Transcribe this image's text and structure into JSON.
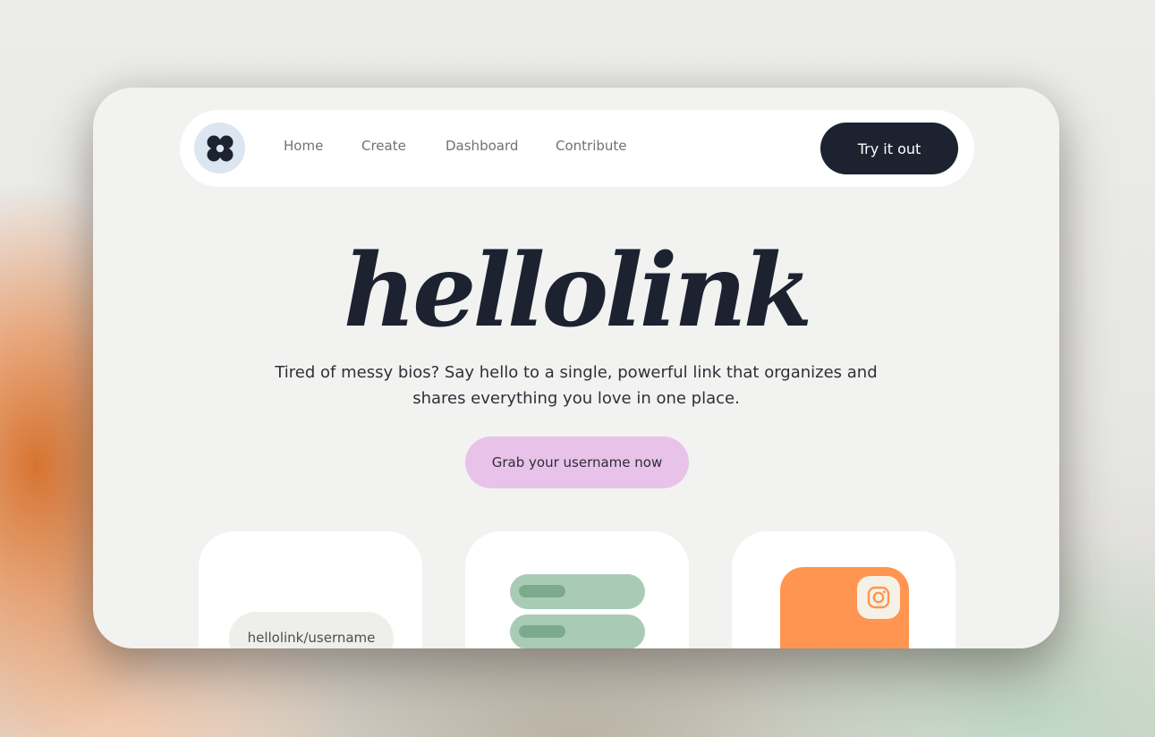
{
  "nav": {
    "logo_icon": "flower-logo-icon",
    "links": [
      {
        "label": "Home"
      },
      {
        "label": "Create"
      },
      {
        "label": "Dashboard"
      },
      {
        "label": "Contribute"
      }
    ],
    "cta_label": "Try it out"
  },
  "hero": {
    "title": "hellolink",
    "subtitle_line1": "Tired of messy bios? Say hello to a single, powerful link that organizes and",
    "subtitle_line2": "shares everything you love in one place.",
    "button_label": "Grab your username now"
  },
  "cards": {
    "username_placeholder": "hellolink/username",
    "social_icon": "instagram-icon"
  },
  "colors": {
    "dark": "#1c2230",
    "accent_pink": "#e8c2e9",
    "accent_green": "#a9cbb6",
    "accent_orange": "#ff9550",
    "logo_bg": "#dbe6f1"
  }
}
